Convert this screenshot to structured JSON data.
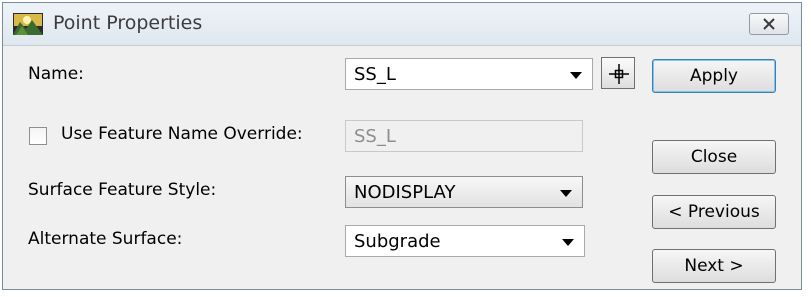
{
  "window": {
    "title": "Point Properties",
    "app_icon": "landscape-icon",
    "close_icon": "close-icon"
  },
  "form": {
    "name": {
      "label": "Name:",
      "value": "SS_L",
      "pick_icon": "crosshair-icon"
    },
    "override": {
      "label": "Use Feature Name Override:",
      "checked": false,
      "value": "SS_L"
    },
    "surface_style": {
      "label": "Surface Feature Style:",
      "value": "NODISPLAY"
    },
    "alternate_surface": {
      "label": "Alternate Surface:",
      "value": "Subgrade"
    }
  },
  "buttons": {
    "apply": "Apply",
    "close": "Close",
    "previous": "< Previous",
    "next": "Next >"
  }
}
